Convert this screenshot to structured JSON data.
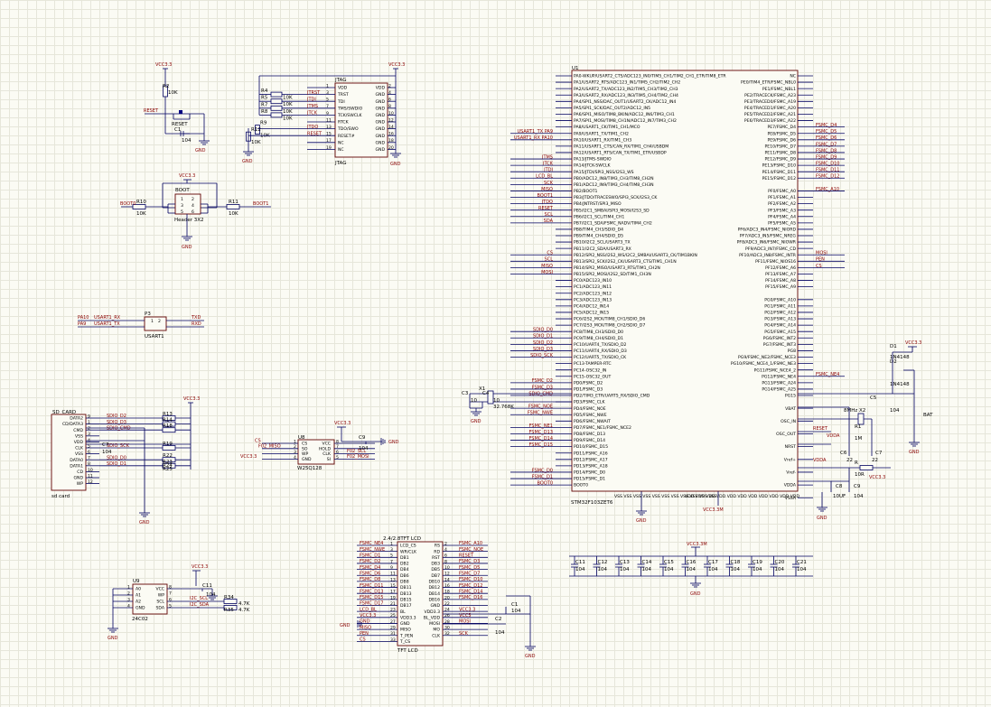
{
  "mcu": {
    "ref": "U1",
    "part": "STM32F103ZET6",
    "left_pins": [
      "PA0-WKUP/USART2_CTS/ADC123_IN0/TIM5_CH1/TIM2_CH1_ETR/TIM8_ETR",
      "PA1/USART2_RTS/ADC123_IN1/TIM5_CH2/TIM2_CH2",
      "PA2/USART2_TX/ADC123_IN2/TIM5_CH3/TIM2_CH3",
      "PA3/USART2_RX/ADC123_IN3/TIM5_CH4/TIM2_CH4",
      "PA4/SPI1_NSS/DAC_OUT1/USART2_CK/ADC12_IN4",
      "PA5/SPI1_SCK/DAC_OUT2/ADC12_IN5",
      "PA6/SPI1_MISO/TIM8_BKIN/ADC12_IN6/TIM3_CH1",
      "PA7/SPI1_MOSI/TIM8_CH1N/ADC12_IN7/TIM3_CH2",
      "PA8/USART1_CK/TIM1_CH1/MCO",
      "PA9/USART1_TX/TIM1_CH2",
      "PA10/USART1_RX/TIM1_CH3",
      "PA11/USART1_CTS/CAN_RX/TIM1_CH4/USBDM",
      "PA12/USART1_RTS/CAN_TX/TIM1_ETR/USBDP",
      "PA13/JTMS-SWDIO",
      "PA14/JTCK-SWCLK",
      "PA15/JTDI/SPI3_NSS/I2S3_WS",
      "PB0/ADC12_IN8/TIM3_CH3/TIM8_CH2N",
      "PB1/ADC12_IN9/TIM3_CH4/TIM8_CH3N",
      "PB2/BOOT1",
      "PB3/JTDO/TRACESWO/SPI3_SCK/I2S3_CK",
      "PB4/JNTRST/SPI3_MISO",
      "PB5/I2C1_SMBAI/SPI3_MOSI/I2S3_SD",
      "PB6/I2C1_SCL/TIM4_CH1",
      "PB7/I2C1_SDA/FSMC_NADV/TIM4_CH2",
      "PB8/TIM4_CH3/SDIO_D4",
      "PB9/TIM4_CH4/SDIO_D5",
      "PB10/I2C2_SCL/USART3_TX",
      "PB11/I2C2_SDA/USART3_RX",
      "PB12/SPI2_NSS/I2S2_WS/I2C2_SMBAI/USART3_CK/TIM1BKIN",
      "PB13/SPI2_SCK/I2S2_CK/USART3_CTS/TIM1_CH1N",
      "PB14/SPI2_MISO/USART3_RTS/TIM1_CH2N",
      "PB15/SPI2_MOSI/I2S2_SD/TIM1_CH3N",
      "PC0/ADC123_IN10",
      "PC1/ADC123_IN11",
      "PC2/ADC123_IN12",
      "PC3/ADC123_IN13",
      "PC4/ADC12_IN14",
      "PC5/ADC12_IN15",
      "PC6/I2S2_MCK/TIM8_CH1/SDIO_D6",
      "PC7/I2S3_MCK/TIM8_CH2/SDIO_D7",
      "PC8/TIM8_CH3/SDIO_D0",
      "PC9/TIM8_CH4/SDIO_D1",
      "PC10/UART4_TX/SDIO_D2",
      "PC11/UART4_RX/SDIO_D3",
      "PC12/UART5_TX/SDIO_CK",
      "PC13-TAMPER-RTC",
      "PC14-OSC32_IN",
      "PC15-OSC32_OUT",
      "PD0/FSMC_D2",
      "PD1/FSMC_D3",
      "PD2/TIM3_ETR/UART5_RX/SDIO_CMD",
      "PD3/FSMC_CLK",
      "PD4/FSMC_NOE",
      "PD5/FSMC_NWE",
      "PD6/FSMC_NWAIT",
      "PD7/FSMC_NE1/FSMC_NCE2",
      "PD8/FSMC_D13",
      "PD9/FSMC_D14",
      "PD10/FSMC_D15",
      "PD11/FSMC_A16",
      "PD12/FSMC_A17",
      "PD13/FSMC_A18",
      "PD14/FSMC_D0",
      "PD15/FSMC_D1",
      "BOOT0"
    ],
    "left_nets": {
      "9": "USART1_TX  PA9",
      "10": "USART1_RX  PA10",
      "13": "JTMS",
      "14": "JTCK",
      "15": "JTDI",
      "16": "LCD_BL",
      "17": "SCK",
      "18": "MISO",
      "19": "BOOT1",
      "20": "JTDO",
      "21": "RESET",
      "22": "SCL",
      "23": "SDA",
      "28": "CS",
      "29": "SCL",
      "30": "MISO",
      "31": "MOSI",
      "40": "SDIO_D0",
      "41": "SDIO_D1",
      "42": "SDIO_D2",
      "43": "SDIO_D3",
      "44": "SDIO_SCK",
      "48": "FSMC_D2",
      "49": "FSMC_D3",
      "50": "SDIO_CMD",
      "52": "FSMC_NOE",
      "53": "FSMC_NWE",
      "55": "FSMC_NE1",
      "56": "FSMC_D13",
      "57": "FSMC_D14",
      "58": "FSMC_D15",
      "62": "FSMC_D0",
      "63": "FSMC_D1",
      "64": "BOOT0"
    },
    "right_pins": [
      "NC",
      "PE0/TIM4_ETR/FSMC_NBL0",
      "PE1/FSMC_NBL1",
      "PE2/TRACECK/FSMC_A23",
      "PE3/TRACED0/FSMC_A19",
      "PE4/TRACED1/FSMC_A20",
      "PE5/TRACED2/FSMC_A21",
      "PE6/TRACED3/FSMC_A22",
      "PE7/FSMC_D4",
      "PE8/FSMC_D5",
      "PE9/FSMC_D6",
      "PE10/FSMC_D7",
      "PE11/FSMC_D8",
      "PE12/FSMC_D9",
      "PE13/FSMC_D10",
      "PE14/FSMC_D11",
      "PE15/FSMC_D12",
      "",
      "PF0/FSMC_A0",
      "PF1/FSMC_A1",
      "PF2/FSMC_A2",
      "PF3/FSMC_A3",
      "PF4/FSMC_A4",
      "PF5/FSMC_A5",
      "PF6/ADC3_IN4/FSMC_NIORD",
      "PF7/ADC3_IN5/FSMC_NREG",
      "PF8/ADC3_IN6/FSMC_NIOWR",
      "PF9/ADC3_IN7/FSMC_CD",
      "PF10/ADC3_IN8/FSMC_INTR",
      "PF11/FSMC_NIOS16",
      "PF12/FSMC_A6",
      "PF13/FSMC_A7",
      "PF14/FSMC_A8",
      "PF15/FSMC_A9",
      "",
      "PG0/FSMC_A10",
      "PG1/FSMC_A11",
      "PG2/FSMC_A12",
      "PG3/FSMC_A13",
      "PG4/FSMC_A14",
      "PG5/FSMC_A15",
      "PG6/FSMC_INT2",
      "PG7/FSMC_INT3",
      "PG8",
      "PG9/FSMC_NE2/FSMC_NCE3",
      "PG10/FSMC_NCE4_1/FSMC_NE3",
      "PG11/FSMC_NCE4_2",
      "PG12/FSMC_NE4",
      "PG13/FSMC_A24",
      "PG14/FSMC_A25",
      "PG15",
      "",
      "VBAT",
      "",
      "OSC_IN",
      "",
      "OSC_OUT",
      "",
      "NRST",
      "",
      "Vref+",
      "",
      "Vref-",
      "",
      "VDDA",
      "",
      "VSSA"
    ],
    "right_nets": {
      "8": "FSMC_D4",
      "9": "FSMC_D5",
      "10": "FSMC_D6",
      "11": "FSMC_D7",
      "12": "FSMC_D8",
      "13": "FSMC_D9",
      "14": "FSMC_D10",
      "15": "FSMC_D11",
      "16": "FSMC_D12",
      "18": "FSMC_A10",
      "28": "MOSI",
      "29": "PEN",
      "30": "CS",
      "47": "FSMC_NE4"
    },
    "bottom_left": "VSS VSS VSS VSS VSS VSS VSS VSS VSS VSS VSS",
    "bottom_right": "VDD VDD VDD VDD VDD VDD VDD VDD VDD VDD VDD",
    "gnd": "GND",
    "vcc": "VCC3.3M"
  },
  "reset": {
    "vcc": "VCC3.3",
    "r_ref": "R2",
    "r_val": "10K",
    "net": "RESET",
    "sw": "RESET",
    "c_ref": "C1",
    "c_val": "104",
    "gnd": "GND"
  },
  "jtag": {
    "ref": "JTAG",
    "title": "JTAG",
    "vcc": "VCC3.3",
    "pins_left": [
      "VDD",
      "TRST",
      "TDI",
      "TMS/SWDIO",
      "TCK/SWCLK",
      "RTCK",
      "TDO/SWO",
      "RESET#",
      "NC",
      "NC"
    ],
    "pins_right": [
      "VDD",
      "GND",
      "GND",
      "GND",
      "GND",
      "GND",
      "GND",
      "GND",
      "GND",
      "GND"
    ],
    "nets": [
      "JTRST",
      "JTDI",
      "JTMS",
      "JTCK",
      "JTDO",
      "RESET"
    ],
    "res": [
      "R4",
      "R5",
      "R7",
      "R8",
      "R9",
      "R12"
    ],
    "res_vals": [
      "10K",
      "10K",
      "10K",
      "10K",
      "10K",
      "10K"
    ],
    "gnd": "GND"
  },
  "boot": {
    "vcc": "VCC3.3",
    "ref": "BOOT",
    "part": "Header 3X2",
    "pins": [
      "1",
      "2",
      "3",
      "4",
      "5",
      "6"
    ],
    "r10": "R10",
    "r11": "R11",
    "r_val": "10K",
    "net0": "BOOT0",
    "net1": "BOOT1",
    "gnd": "GND"
  },
  "usart": {
    "ref": "P3",
    "part": "USART1",
    "pa10": "PA10",
    "pa9": "PA9",
    "rx": "USART1_RX",
    "tx": "USART1_TX",
    "txd": "TXD",
    "rxd": "RXD",
    "pins": [
      "1",
      "2"
    ]
  },
  "sd": {
    "ref": "SD_CARD",
    "part": "sd card",
    "pins": [
      "DATA2",
      "CD/DATA3",
      "CMD",
      "VSS",
      "VDD",
      "CLK",
      "VSS",
      "DATA0",
      "DATA1",
      "CD",
      "GND",
      "WP"
    ],
    "nums": [
      "9",
      "1",
      "2",
      "3",
      "4",
      "5",
      "6",
      "7",
      "8",
      "10",
      "11",
      "12"
    ],
    "nets": [
      "SDIO_D2",
      "SDIO_D3",
      "SDIO_CMD",
      "SDIO_SCK",
      "SDIO_D0",
      "SDIO_D1"
    ],
    "res": [
      "R13",
      "R14",
      "R18",
      "R19",
      "R22",
      "R23",
      "R24",
      "R25"
    ],
    "vcc": "VCC3.3",
    "gnd": "GND",
    "c_ref": "C7",
    "c_val": "104"
  },
  "flash": {
    "ref": "U8",
    "part": "W25Q128",
    "vcc": "VCC3.3",
    "pins_left": [
      "CS",
      "SO",
      "WP",
      "GND"
    ],
    "pins_right": [
      "VCC",
      "HOLD",
      "CLK",
      "SI"
    ],
    "nets_left": [
      "CS",
      "F02_MISO",
      "VCC3.3"
    ],
    "nets_right": [
      "F02_SCL",
      "F02_MOSI"
    ],
    "c_ref": "C9",
    "c_val": "104",
    "gnd": "GND"
  },
  "eeprom": {
    "ref": "U9",
    "part": "24C02",
    "vcc": "VCC3.3",
    "pins_left": [
      "A0",
      "A1",
      "A2",
      "GND"
    ],
    "pins_right": [
      "VCC",
      "WP",
      "SCL",
      "SDA"
    ],
    "nets": [
      "I2C_SCL",
      "I2C_SDA"
    ],
    "res": [
      "R34",
      "R35"
    ],
    "res_val": "4.7K",
    "c_ref": "C11",
    "c_val": "104",
    "gnd": "GND"
  },
  "lcd": {
    "header": "2.4/2.8TFT LCD",
    "part": "TFT LCD",
    "pins_left": [
      "LCD_CS",
      "WR/CLK",
      "DB1",
      "DB2",
      "DB4",
      "DB6",
      "DB8",
      "DB11",
      "DB13",
      "DB15",
      "DB17",
      "BL",
      "VDD3.3",
      "GND",
      "MISO",
      "T_PEN",
      "T_CS"
    ],
    "pins_right": [
      "RS",
      "RD",
      "RST",
      "DB3",
      "DB5",
      "DB7",
      "DB10",
      "DB12",
      "DB14",
      "DB16",
      "GND",
      "VDD3.3",
      "BL_VDD",
      "MOSI",
      "MO",
      "CLK",
      ""
    ],
    "nets_left": [
      "FSMC_NE4",
      "FSMC_NWE",
      "FSMC_D1",
      "FSMC_D2",
      "FSMC_D4",
      "FSMC_D6",
      "FSMC_D8",
      "FSMC_D11",
      "FSMC_D13",
      "FSMC_D15",
      "FSMC_D17",
      "LCD_BL",
      "VCC3.3",
      "GND",
      "MISO",
      "PEN",
      "CS"
    ],
    "nets_right": [
      "FSMC_A10",
      "FSMC_NOE",
      "RESET",
      "FSMC_D3",
      "FSMC_D5",
      "FSMC_D7",
      "FSMC_D10",
      "FSMC_D12",
      "FSMC_D14",
      "FSMC_D16",
      "",
      "VCC3.3",
      "VCC5",
      "MOSI",
      "",
      "SCK",
      ""
    ],
    "c1": "C1",
    "c2": "C2",
    "c_val": "104",
    "gnd": "GND"
  },
  "osc": {
    "x1": "X1",
    "x1_val": "32.768K",
    "c3": "C3",
    "c4": "C4",
    "c_val": "10",
    "gnd": "GND",
    "x2": "X2",
    "x2_val": "8MHz",
    "r1": "R1",
    "r1_val": "1M",
    "c6": "C6",
    "c7": "C7",
    "c67_val": "22",
    "reset": "RESET",
    "vdda": "VDDA",
    "r": "R",
    "r_val": "10R",
    "c8": "C8",
    "c9": "C9",
    "c8_val": "10UF",
    "c9_val": "104",
    "vcc": "VCC3.3"
  },
  "bat": {
    "vcc": "VCC3.3",
    "d1": "D1",
    "d2": "D2",
    "d_val": "1N4148",
    "c5": "C5",
    "c5_val": "104",
    "bat": "BAT",
    "gnd": "GND"
  },
  "decoup": {
    "vcc": "VCC3.3M",
    "caps": [
      "C11",
      "C12",
      "C13",
      "C14",
      "C15",
      "C16",
      "C17",
      "C18",
      "C19",
      "C20",
      "C21"
    ],
    "val": "104",
    "gnd": "GND"
  }
}
